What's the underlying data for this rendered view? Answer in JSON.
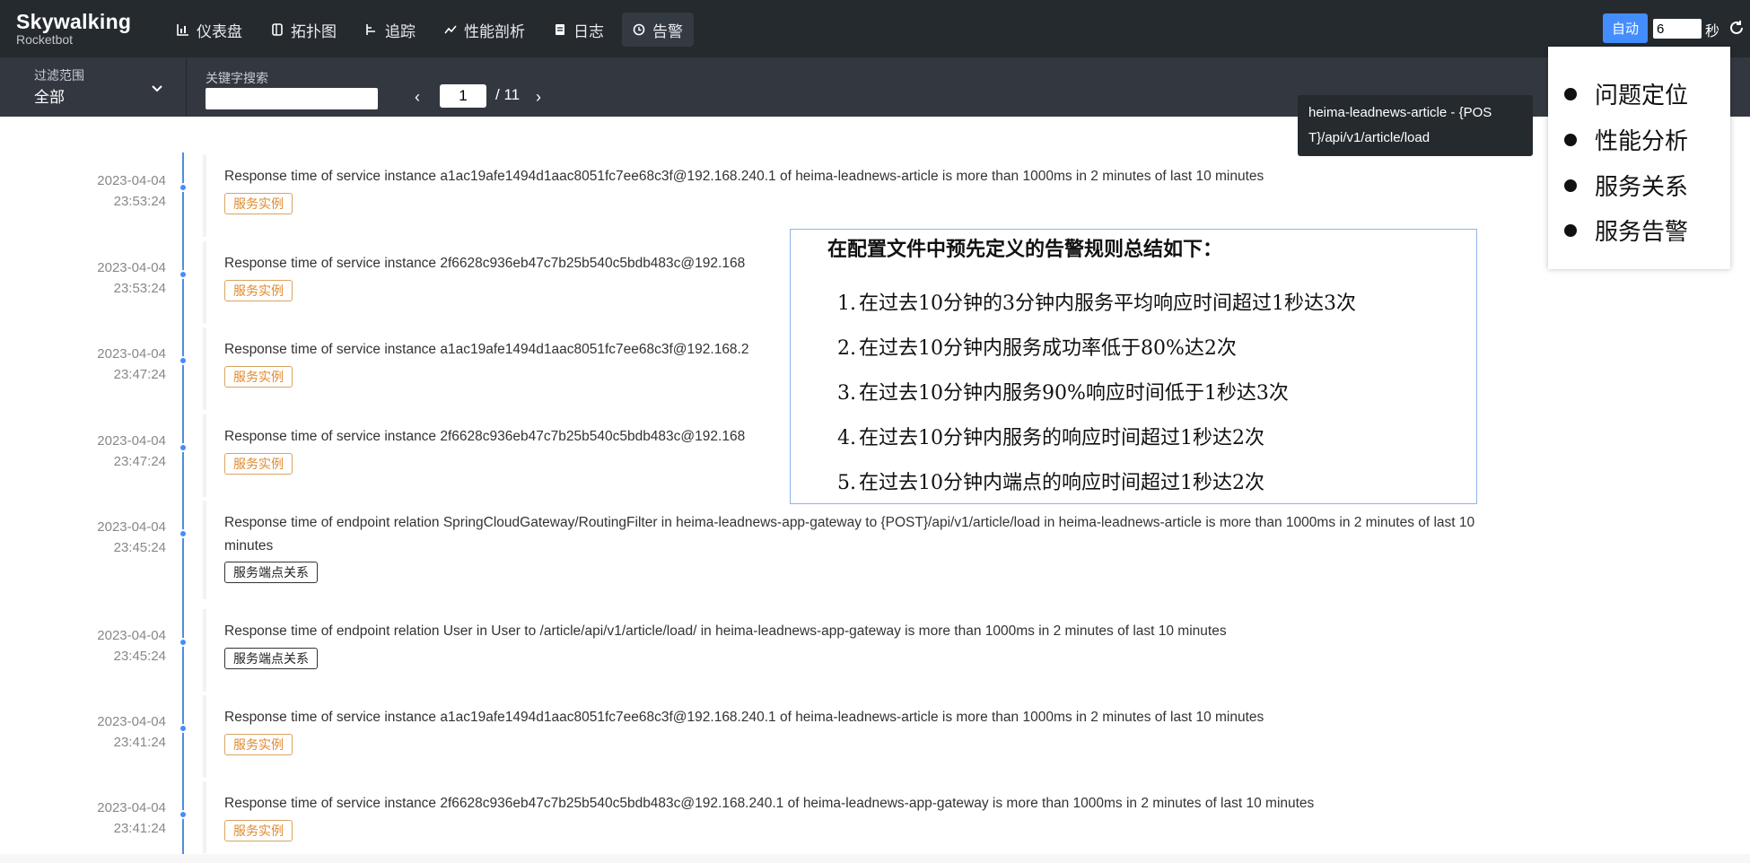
{
  "app": {
    "brand": "Skywalking",
    "subtitle": "Rocketbot"
  },
  "nav": {
    "items": [
      {
        "label": "仪表盘",
        "icon": "dashboard-icon"
      },
      {
        "label": "拓扑图",
        "icon": "topology-icon"
      },
      {
        "label": "追踪",
        "icon": "trace-icon"
      },
      {
        "label": "性能剖析",
        "icon": "profile-icon"
      },
      {
        "label": "日志",
        "icon": "log-icon"
      },
      {
        "label": "告警",
        "icon": "alarm-icon",
        "active": true
      }
    ],
    "auto_label": "自动",
    "interval_value": "6",
    "interval_unit": "秒"
  },
  "filter": {
    "scope_label": "过滤范围",
    "scope_value": "全部",
    "keyword_label": "关键字搜索",
    "keyword_value": "",
    "page_current": "1",
    "page_total": "/ 11"
  },
  "alarms": [
    {
      "date": "2023-04-04",
      "time": "23:53:24",
      "message": "Response time of service instance a1ac19afe1494d1aac8051fc7ee68c3f@192.168.240.1 of heima-leadnews-article is more than 1000ms in 2 minutes of last 10 minutes",
      "tag": "服务实例",
      "tag_type": "instance"
    },
    {
      "date": "2023-04-04",
      "time": "23:53:24",
      "message": "Response time of service instance 2f6628c936eb47c7b25b540c5bdb483c@192.168",
      "tag": "服务实例",
      "tag_type": "instance"
    },
    {
      "date": "2023-04-04",
      "time": "23:47:24",
      "message": "Response time of service instance a1ac19afe1494d1aac8051fc7ee68c3f@192.168.2",
      "tag": "服务实例",
      "tag_type": "instance"
    },
    {
      "date": "2023-04-04",
      "time": "23:47:24",
      "message": "Response time of service instance 2f6628c936eb47c7b25b540c5bdb483c@192.168",
      "tag": "服务实例",
      "tag_type": "instance"
    },
    {
      "date": "2023-04-04",
      "time": "23:45:24",
      "message": "Response time of endpoint relation SpringCloudGateway/RoutingFilter in heima-leadnews-app-gateway to {POST}/api/v1/article/load in heima-leadnews-article is more than 1000ms in 2 minutes of last 10 minutes",
      "tag": "服务端点关系",
      "tag_type": "relation"
    },
    {
      "date": "2023-04-04",
      "time": "23:45:24",
      "message": "Response time of endpoint relation User in User to /article/api/v1/article/load/ in heima-leadnews-app-gateway is more than 1000ms in 2 minutes of last 10 minutes",
      "tag": "服务端点关系",
      "tag_type": "relation"
    },
    {
      "date": "2023-04-04",
      "time": "23:41:24",
      "message": "Response time of service instance a1ac19afe1494d1aac8051fc7ee68c3f@192.168.240.1 of heima-leadnews-article is more than 1000ms in 2 minutes of last 10 minutes",
      "tag": "服务实例",
      "tag_type": "instance"
    },
    {
      "date": "2023-04-04",
      "time": "23:41:24",
      "message": "Response time of service instance 2f6628c936eb47c7b25b540c5bdb483c@192.168.240.1 of heima-leadnews-app-gateway is more than 1000ms in 2 minutes of last 10 minutes",
      "tag": "服务实例",
      "tag_type": "instance"
    }
  ],
  "tooltip": {
    "line1": "heima-leadnews-article - {POS",
    "line2": "T}/api/v1/article/load"
  },
  "toc": {
    "items": [
      "问题定位",
      "性能分析",
      "服务关系",
      "服务告警"
    ]
  },
  "rules": {
    "title": "在配置文件中预先定义的告警规则总结如下：",
    "items": [
      "在过去10分钟的3分钟内服务平均响应时间超过1秒达3次",
      "在过去10分钟内服务成功率低于80%达2次",
      "在过去10分钟内服务90%响应时间低于1秒达3次",
      "在过去10分钟内服务的响应时间超过1秒达2次",
      "在过去10分钟内端点的响应时间超过1秒达2次"
    ]
  },
  "colors": {
    "topbar": "#252a2f",
    "filterbar": "#333840",
    "accent": "#448dfe",
    "instance_tag": "#e08a2e"
  }
}
